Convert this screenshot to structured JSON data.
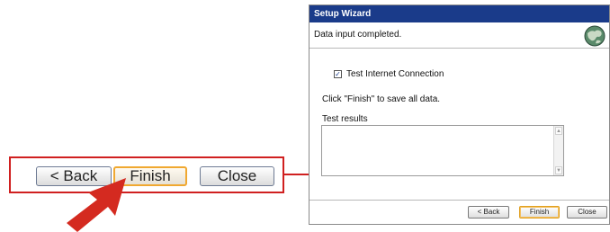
{
  "callout": {
    "back_label": "< Back",
    "finish_label": "Finish",
    "close_label": "Close"
  },
  "dialog": {
    "title": "Setup Wizard",
    "header_text": "Data input completed.",
    "header_icon": "globe-icon",
    "checkbox_label": "Test Internet Connection",
    "checkbox_checked": true,
    "info_text": "Click \"Finish\" to save all data.",
    "results_label": "Test results",
    "results_value": "",
    "buttons": {
      "back_label": "< Back",
      "finish_label": "Finish",
      "close_label": "Close"
    }
  },
  "colors": {
    "annotation": "#d02020",
    "titlebar": "#1a3b8a",
    "focus_border": "#f0a830"
  }
}
